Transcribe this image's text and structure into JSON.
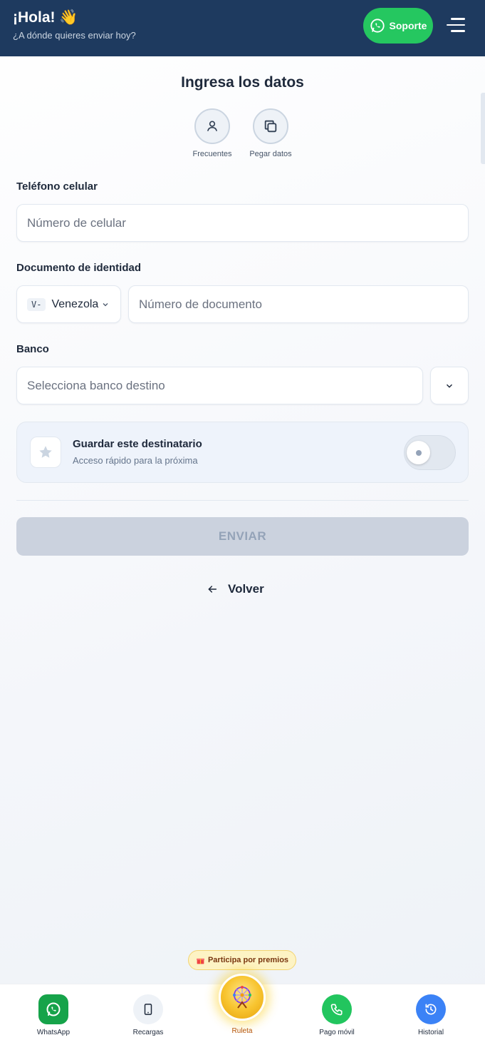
{
  "header": {
    "greeting": "¡Hola! 👋",
    "subtitle": "¿A dónde quieres enviar hoy?",
    "support_label": "Soporte",
    "colors": {
      "header_bg": "#1e3a5f",
      "whatsapp_green": "#25c760"
    }
  },
  "form": {
    "title": "Ingresa los datos",
    "quick_actions": [
      {
        "label": "Frecuentes",
        "icon": "user-icon"
      },
      {
        "label": "Pegar datos",
        "icon": "copy-icon"
      }
    ],
    "phone": {
      "label": "Teléfono celular",
      "placeholder": "Número de celular"
    },
    "document": {
      "label": "Documento de identidad",
      "prefix": "V-",
      "country": "Venezola",
      "placeholder": "Número de documento"
    },
    "bank": {
      "label": "Banco",
      "placeholder": "Selecciona banco destino"
    },
    "save_recipient": {
      "title": "Guardar este destinatario",
      "subtitle": "Acceso rápido para la próxima",
      "enabled": false
    },
    "send_label": "ENVIAR",
    "back_label": "Volver"
  },
  "promo": {
    "label": "Participa por premios"
  },
  "bottom_nav": {
    "items": [
      {
        "label": "WhatsApp",
        "icon": "whatsapp-icon"
      },
      {
        "label": "Recargas",
        "icon": "phone-device-icon"
      },
      {
        "label": "Ruleta",
        "icon": "ferris-wheel-icon"
      },
      {
        "label": "Pago móvil",
        "icon": "call-icon"
      },
      {
        "label": "Historial",
        "icon": "history-icon"
      }
    ]
  }
}
